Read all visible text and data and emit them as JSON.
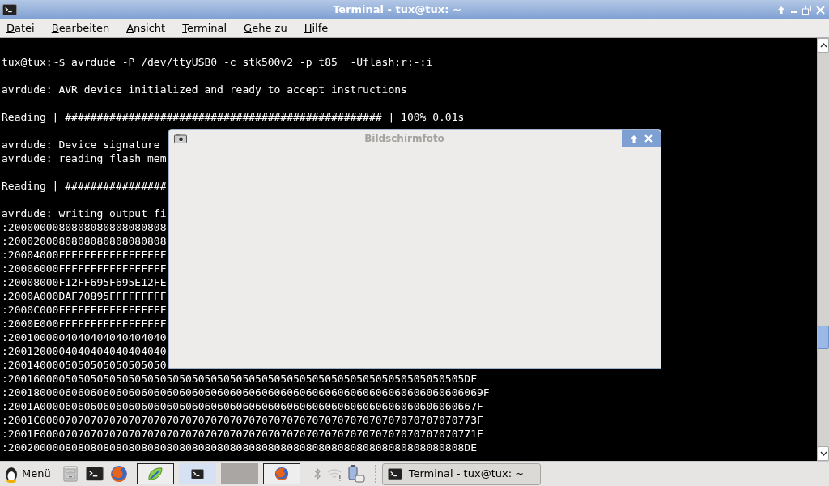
{
  "window": {
    "title": "Terminal - tux@tux: ~"
  },
  "menu": [
    "Datei",
    "Bearbeiten",
    "Ansicht",
    "Terminal",
    "Gehe zu",
    "Hilfe"
  ],
  "terminal_blocks": [
    [
      "tux@tux:~$ avrdude -P /dev/ttyUSB0 -c stk500v2 -p t85  -Uflash:r:-:i"
    ],
    [
      "avrdude: AVR device initialized and ready to accept instructions"
    ],
    [
      "Reading | ################################################## | 100% 0.01s"
    ],
    [
      "avrdude: Device signature ",
      "avrdude: reading flash mem"
    ],
    [
      "Reading | ################"
    ],
    [
      "avrdude: writing output fi",
      ":2000000080808080808080808",
      ":2000200080808080808080808",
      ":20004000FFFFFFFFFFFFFFFFF",
      ":20006000FFFFFFFFFFFFFFFFF",
      ":20008000F12FF695F695E12FE",
      ":2000A000DAF70895FFFFFFFFF",
      ":2000C000FFFFFFFFFFFFFFFFF",
      ":2000E000FFFFFFFFFFFFFFFFF",
      ":2001000004040404040404040",
      ":2001200004040404040404040",
      ":2001400005050505050505050",
      ":200160000505050505050505050505050505050505050505050505050505050505050505DF",
      ":200180000606060606060606060606060606060606060606060606060606060606060606069F",
      ":2001A000060606060606060606060606060606060606060606060606060606060606060667F",
      ":2001C000070707070707070707070707070707070707070707070707070707070707070773F",
      ":2001E000070707070707070707070707070707070707070707070707070707070707070771F",
      ":200200000808080808080808080808080808080808080808080808080808080808080808DE"
    ]
  ],
  "dialog": {
    "title": "Bildschirmfoto"
  },
  "taskbar": {
    "menu_label": "Menü",
    "launchers": [
      {
        "kind": "files"
      },
      {
        "kind": "terminal"
      },
      {
        "kind": "browser"
      }
    ],
    "workspaces": [
      {
        "kind": "leaf",
        "selected": false
      },
      {
        "kind": "terminal",
        "selected": true
      },
      {
        "kind": "empty",
        "selected": false
      },
      {
        "kind": "browser",
        "selected": false
      }
    ],
    "task": "Terminal - tux@tux: ~"
  }
}
